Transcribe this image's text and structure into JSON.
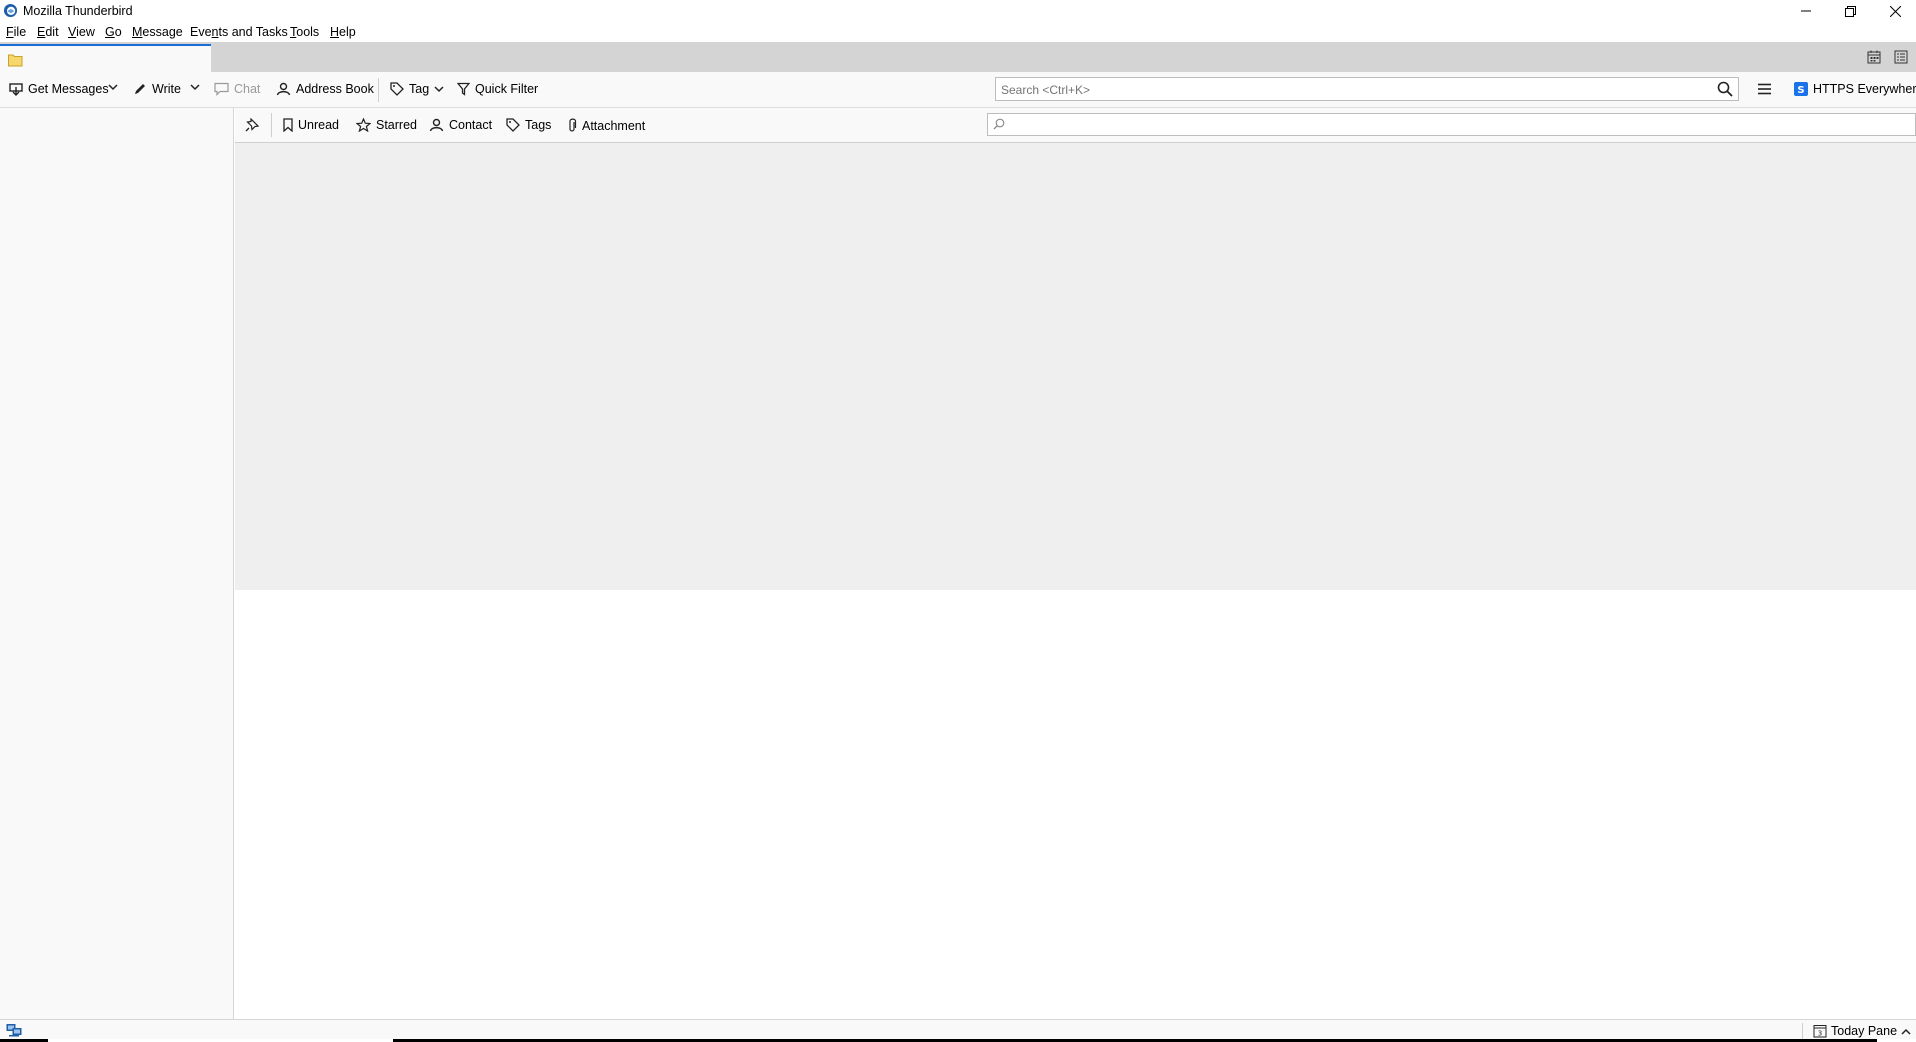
{
  "window": {
    "title": "Mozilla Thunderbird"
  },
  "menubar": {
    "items": [
      {
        "key": "F",
        "rest": "ile"
      },
      {
        "key": "E",
        "rest": "dit"
      },
      {
        "key": "V",
        "rest": "iew"
      },
      {
        "key": "G",
        "rest": "o"
      },
      {
        "key": "M",
        "rest": "essage"
      },
      {
        "key": "",
        "pre": "Eve",
        "ul": "n",
        "rest": "ts and Tasks"
      },
      {
        "key": "T",
        "rest": "ools"
      },
      {
        "key": "H",
        "rest": "elp"
      }
    ]
  },
  "toolbar": {
    "get_messages": "Get Messages",
    "write": "Write",
    "chat": "Chat",
    "address_book": "Address Book",
    "tag": "Tag",
    "quick_filter": "Quick Filter",
    "search_placeholder": "Search <Ctrl+K>",
    "https_everywhere": "HTTPS Everywhere"
  },
  "quickfilter": {
    "unread": "Unread",
    "starred": "Starred",
    "contact": "Contact",
    "tags": "Tags",
    "attachment": "Attachment",
    "search_placeholder": ""
  },
  "statusbar": {
    "today_pane": "Today Pane"
  },
  "colors": {
    "accent": "#1a6ed6",
    "https_everywhere": "#1a73e8"
  }
}
